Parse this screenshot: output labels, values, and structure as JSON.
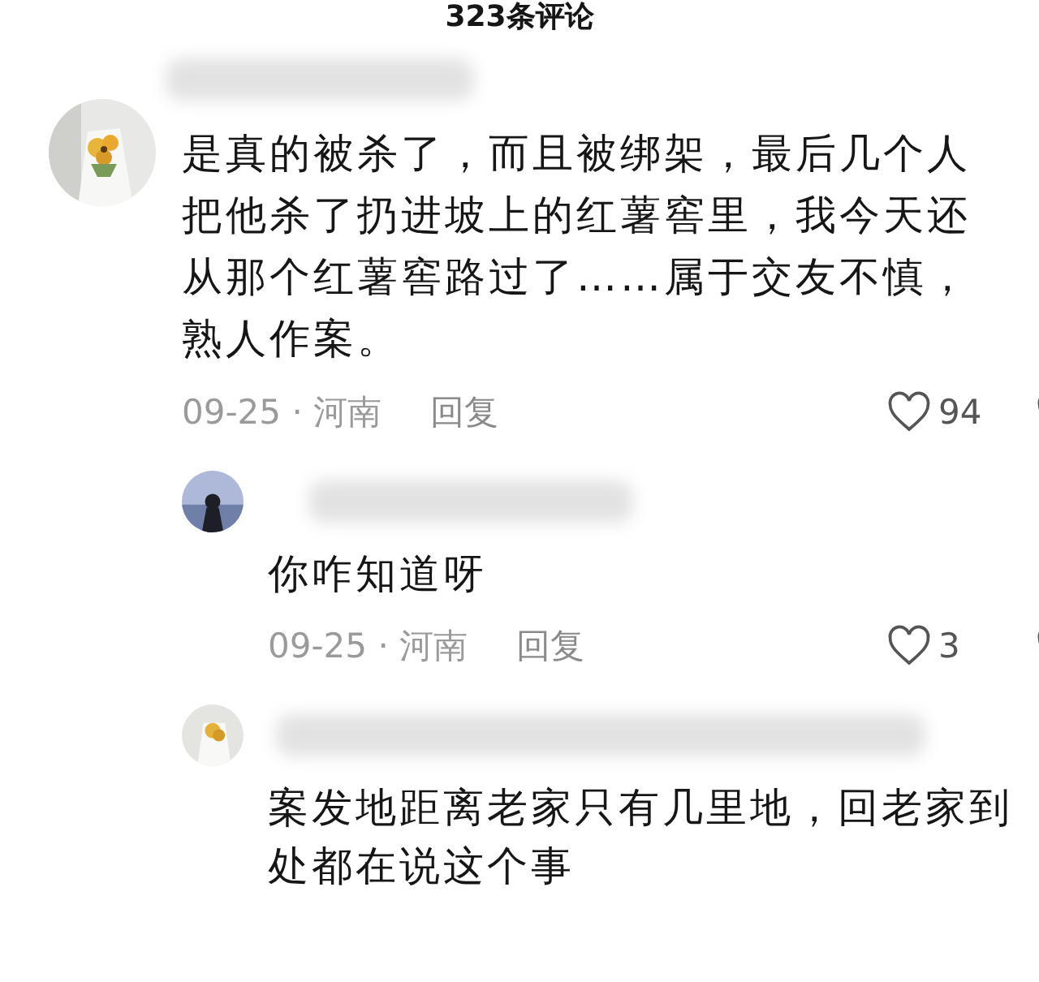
{
  "header": {
    "title": "323条评论"
  },
  "comments": [
    {
      "text": "是真的被杀了，而且被绑架，最后几个人把他杀了扔进坡上的红薯窖里，我今天还从那个红薯窖路过了……属于交友不慎，熟人作案。",
      "date_location": "09-25 · 河南",
      "reply_label": "回复",
      "likes": "94",
      "replies": [
        {
          "text": "你咋知道呀",
          "date_location": "09-25 · 河南",
          "reply_label": "回复",
          "likes": "3"
        },
        {
          "text": "案发地距离老家只有几里地，回老家到处都在说这个事"
        }
      ]
    }
  ]
}
